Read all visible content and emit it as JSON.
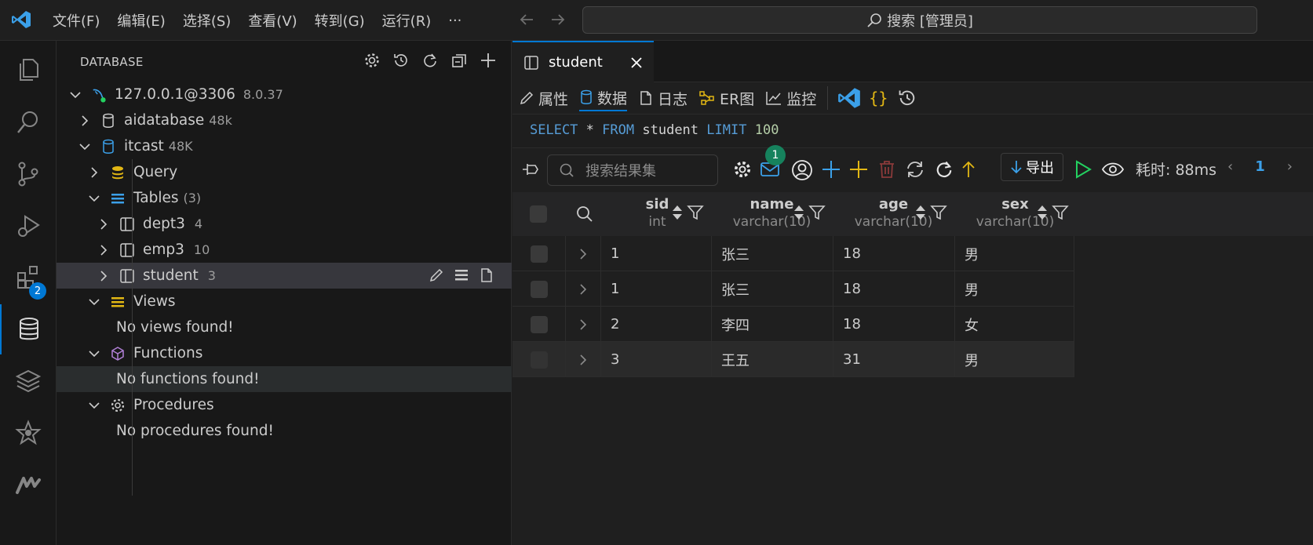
{
  "menu": [
    "文件(F)",
    "编辑(E)",
    "选择(S)",
    "查看(V)",
    "转到(G)",
    "运行(R)",
    "···"
  ],
  "search": {
    "label": "搜索 [管理员]"
  },
  "activity": {
    "extensions_badge": "2"
  },
  "sidebar": {
    "title": "DATABASE",
    "connection": {
      "name": "127.0.0.1@3306",
      "version": "8.0.37"
    },
    "db1": {
      "name": "aidatabase",
      "size": "48k"
    },
    "db2": {
      "name": "itcast",
      "size": "48K"
    },
    "query": "Query",
    "tables": {
      "label": "Tables",
      "count": "(3)"
    },
    "table_items": [
      {
        "name": "dept3",
        "count": "4"
      },
      {
        "name": "emp3",
        "count": "10"
      },
      {
        "name": "student",
        "count": "3"
      }
    ],
    "views": "Views",
    "views_empty": "No views found!",
    "functions": "Functions",
    "functions_empty": "No functions found!",
    "procedures": "Procedures",
    "procedures_empty": "No procedures found!"
  },
  "editor": {
    "tab_title": "student",
    "toolbar": [
      "属性",
      "数据",
      "日志",
      "ER图",
      "监控"
    ],
    "sql": {
      "kw1": "SELECT",
      "star": "*",
      "kw2": "FROM",
      "table": "student",
      "kw3": "LIMIT",
      "limit": "100"
    },
    "result_search_placeholder": "搜索结果集",
    "notification_count": "1",
    "export_label": "导出",
    "timing": "耗时: 88ms",
    "page": "1"
  },
  "grid": {
    "columns": [
      {
        "name": "sid",
        "type": "int"
      },
      {
        "name": "name",
        "type": "varchar(10)"
      },
      {
        "name": "age",
        "type": "varchar(10)"
      },
      {
        "name": "sex",
        "type": "varchar(10)"
      }
    ],
    "rows": [
      [
        "1",
        "张三",
        "18",
        "男"
      ],
      [
        "1",
        "张三",
        "18",
        "男"
      ],
      [
        "2",
        "李四",
        "18",
        "女"
      ],
      [
        "3",
        "王五",
        "31",
        "男"
      ]
    ]
  },
  "colors": {
    "accent": "#0078d4",
    "keyword": "#569cd6",
    "number": "#b5cea8",
    "green": "#16825d",
    "yellow": "#e2b714"
  }
}
